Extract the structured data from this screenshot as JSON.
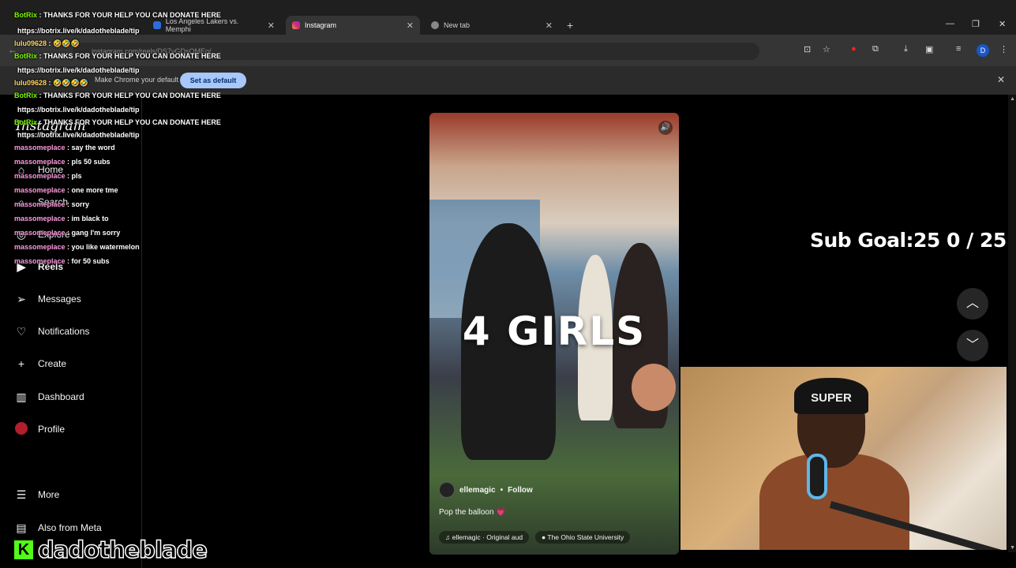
{
  "browser": {
    "tabs": [
      {
        "label": "Los Angeles Lakers vs. Memphi",
        "active": false
      },
      {
        "label": "Instagram",
        "active": true
      },
      {
        "label": "New tab",
        "active": false
      }
    ],
    "url": "instagram.com/reels/DS7yGDsQMEq/",
    "infobar_text": "Make Chrome your default browser",
    "set_default_label": "Set as default",
    "profile_initial": "D"
  },
  "sidebar": {
    "logo": "Instagram",
    "items": [
      {
        "label": "Home",
        "icon": "home-icon"
      },
      {
        "label": "Search",
        "icon": "search-icon"
      },
      {
        "label": "Explore",
        "icon": "compass-icon"
      },
      {
        "label": "Reels",
        "icon": "reels-icon"
      },
      {
        "label": "Messages",
        "icon": "messages-icon"
      },
      {
        "label": "Notifications",
        "icon": "heart-icon"
      },
      {
        "label": "Create",
        "icon": "plus-icon"
      },
      {
        "label": "Dashboard",
        "icon": "dashboard-icon"
      },
      {
        "label": "Profile",
        "icon": "avatar-icon"
      },
      {
        "label": "More",
        "icon": "menu-icon"
      },
      {
        "label": "Also from Meta",
        "icon": "meta-icon"
      }
    ]
  },
  "reel": {
    "overlay_text": "4 GIRLS",
    "author": "ellemagic",
    "separator": "•",
    "follow_label": "Follow",
    "caption": "Pop the balloon 💗",
    "audio": "ellemagic · Original aud",
    "location": "The Ohio State University"
  },
  "stream": {
    "sub_goal": "Sub Goal:25  0 / 25",
    "beanie_text": "SUPER",
    "watermark": "dadotheblade",
    "chat": [
      {
        "user": "BotRix",
        "msg": "THANKS FOR YOUR HELP YOU CAN DONATE HERE",
        "type": "bot"
      },
      {
        "user": "",
        "msg": "https://botrix.live/k/dadotheblade/tip",
        "type": "url"
      },
      {
        "user": "lulu09628",
        "msg": "🤣🤣🤣",
        "type": "lulu"
      },
      {
        "user": "BotRix",
        "msg": "THANKS FOR YOUR HELP YOU CAN DONATE HERE",
        "type": "bot"
      },
      {
        "user": "",
        "msg": "https://botrix.live/k/dadotheblade/tip",
        "type": "url"
      },
      {
        "user": "lulu09628",
        "msg": "🤣🤣🤣🤣",
        "type": "lulu"
      },
      {
        "user": "BotRix",
        "msg": "THANKS FOR YOUR HELP YOU CAN DONATE HERE",
        "type": "bot"
      },
      {
        "user": "",
        "msg": "https://botrix.live/k/dadotheblade/tip",
        "type": "url"
      },
      {
        "user": "BotRix",
        "msg": "THANKS FOR YOUR HELP YOU CAN DONATE HERE",
        "type": "bot"
      },
      {
        "user": "",
        "msg": "https://botrix.live/k/dadotheblade/tip",
        "type": "url"
      },
      {
        "user": "massomeplace",
        "msg": "say the word",
        "type": "user"
      },
      {
        "user": "massomeplace",
        "msg": "pls 50 subs",
        "type": "user"
      },
      {
        "user": "massomeplace",
        "msg": "pls",
        "type": "user"
      },
      {
        "user": "massomeplace",
        "msg": "one more tme",
        "type": "user"
      },
      {
        "user": "massomeplace",
        "msg": "sorry",
        "type": "user"
      },
      {
        "user": "massomeplace",
        "msg": "im black to",
        "type": "user"
      },
      {
        "user": "massomeplace",
        "msg": "gang I'm sorry",
        "type": "user"
      },
      {
        "user": "massomeplace",
        "msg": "you like watermelon",
        "type": "user"
      },
      {
        "user": "massomeplace",
        "msg": "for 50 subs",
        "type": "user"
      }
    ]
  }
}
